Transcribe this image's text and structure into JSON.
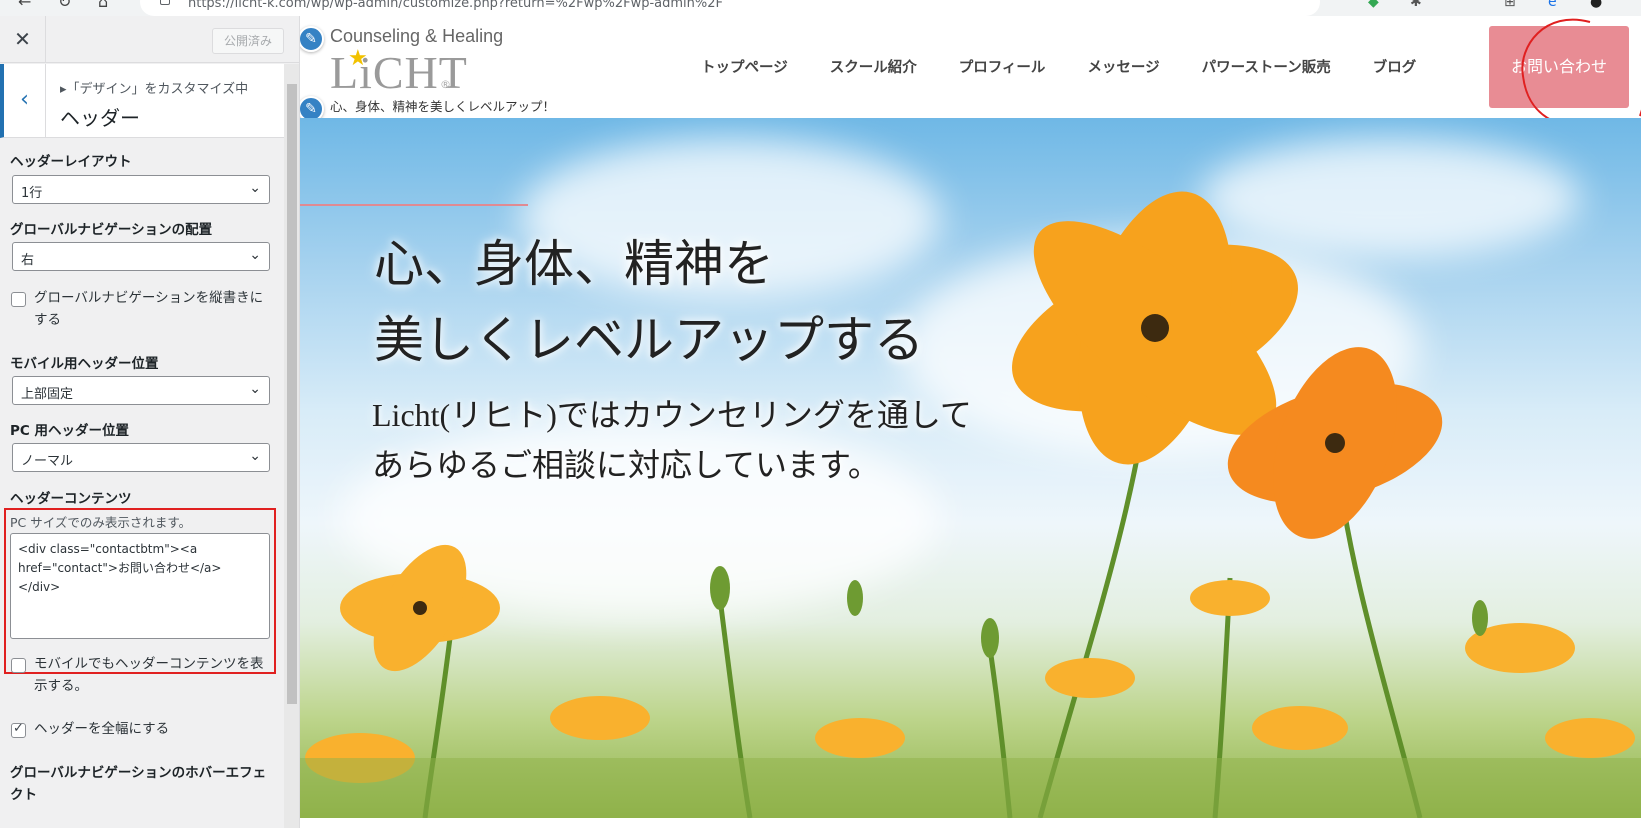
{
  "browser": {
    "url": "https://licht-k.com/wp/wp-admin/customize.php?return=%2Fwp%2Fwp-admin%2F"
  },
  "customizer": {
    "close_label": "✕",
    "publish_label": "公開済み",
    "breadcrumb": "▸「デザイン」をカスタマイズ中",
    "section_title": "ヘッダー",
    "header_layout": {
      "label": "ヘッダーレイアウト",
      "value": "1行"
    },
    "gnav_position": {
      "label": "グローバルナビゲーションの配置",
      "value": "右"
    },
    "gnav_vertical": {
      "label": "グローバルナビゲーションを縦書きにする",
      "checked": false
    },
    "mobile_header_position": {
      "label": "モバイル用ヘッダー位置",
      "value": "上部固定"
    },
    "pc_header_position": {
      "label": "PC 用ヘッダー位置",
      "value": "ノーマル"
    },
    "header_content": {
      "label": "ヘッダーコンテンツ",
      "description": "PC サイズでのみ表示されます。",
      "value": "<div class=\"contactbtm\"><a href=\"contact\">お問い合わせ</a></div>"
    },
    "mobile_header_content": {
      "label": "モバイルでもヘッダーコンテンツを表示する。",
      "checked": false
    },
    "full_width_header": {
      "label": "ヘッダーを全幅にする",
      "checked": true
    },
    "gnav_hover_effect": {
      "label": "グローバルナビゲーションのホバーエフェクト"
    }
  },
  "site": {
    "logo_subtitle": "Counseling & Healing",
    "logo_text": "LiCHT",
    "logo_reg": "®",
    "tagline": "心、身体、精神を美しくレベルアップ！",
    "nav": [
      "トップページ",
      "スクール紹介",
      "プロフィール",
      "メッセージ",
      "パワーストーン販売",
      "ブログ"
    ],
    "contact_button": "お問い合わせ",
    "hero": {
      "heading_line1": "心、身体、精神を",
      "heading_line2": "美しくレベルアップする",
      "text_line1": "Licht(リヒト)ではカウンセリングを通して",
      "text_line2": "あらゆるご相談に対応しています。"
    }
  },
  "colors": {
    "accent": "#2271b1",
    "contact_button": "#e88c94",
    "annotation_red": "#e02020"
  }
}
